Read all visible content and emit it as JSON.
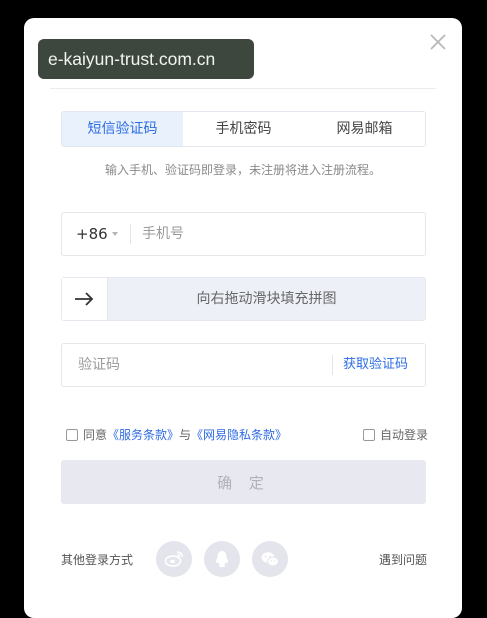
{
  "watermark": "e-kaiyun-trust.com.cn",
  "tabs": [
    {
      "label": "短信验证码",
      "active": true
    },
    {
      "label": "手机密码",
      "active": false
    },
    {
      "label": "网易邮箱",
      "active": false
    }
  ],
  "hint": "输入手机、验证码即登录，未注册将进入注册流程。",
  "phone": {
    "country_code": "+86",
    "placeholder": "手机号"
  },
  "slider": {
    "text": "向右拖动滑块填充拼图"
  },
  "code": {
    "placeholder": "验证码",
    "get_code_label": "获取验证码"
  },
  "agreement": {
    "prefix": "同意",
    "service_terms": "《服务条款》",
    "conjunction": "与",
    "privacy_terms": "《网易隐私条款》",
    "auto_login": "自动登录"
  },
  "confirm_label": "确 定",
  "other_login_label": "其他登录方式",
  "social": [
    "weibo-icon",
    "qq-icon",
    "wechat-icon"
  ],
  "help_label": "遇到问题",
  "colors": {
    "accent": "#2d6be3",
    "tab_active_bg": "#e9f1fd",
    "button_disabled_bg": "#e7e8f0"
  }
}
